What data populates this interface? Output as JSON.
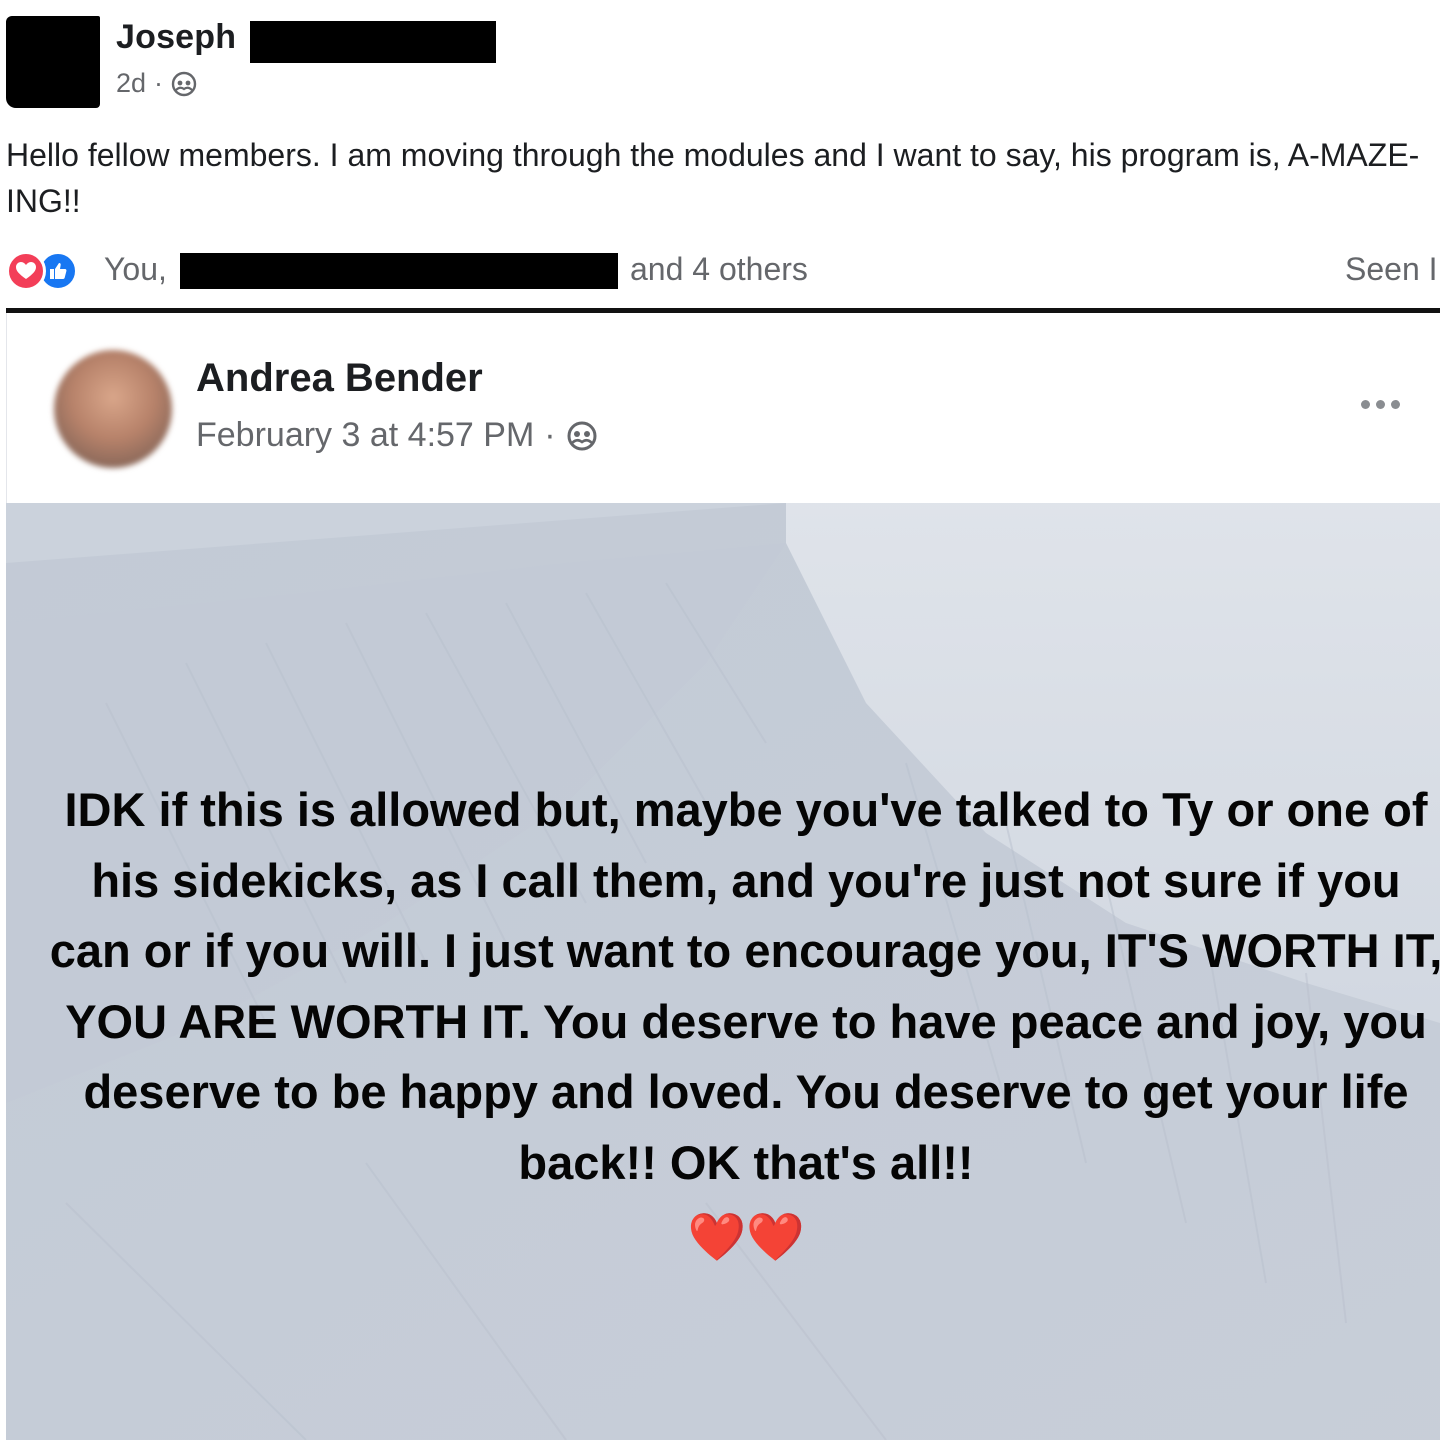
{
  "post1": {
    "author_first_name": "Joseph",
    "timestamp": "2d",
    "separator": "·",
    "body": "Hello fellow members. I am moving through the modules and I want to say, his program is, A-MAZE-ING!!",
    "reactions": {
      "icons": [
        "love-icon",
        "like-icon"
      ],
      "love_color": "#f33e58",
      "like_color": "#1877f2",
      "label_prefix": "You,",
      "label_suffix": "and 4 others"
    },
    "seen_label": "Seen I"
  },
  "post2": {
    "author": "Andrea Bender",
    "timestamp": "February 3 at 4:57 PM",
    "separator": "·",
    "more_icon": "more-options-icon",
    "body": "IDK if this is allowed but, maybe you've talked to Ty or one of his sidekicks, as I call them, and you're just not sure if you can or if you will. I just want to encourage you, IT'S WORTH IT, YOU ARE WORTH IT. You deserve to have peace and joy, you deserve to be happy and loved. You deserve to get your life back!! OK that's all!!",
    "emoji": "❤️❤️",
    "background_color": "#cbd2dd"
  }
}
